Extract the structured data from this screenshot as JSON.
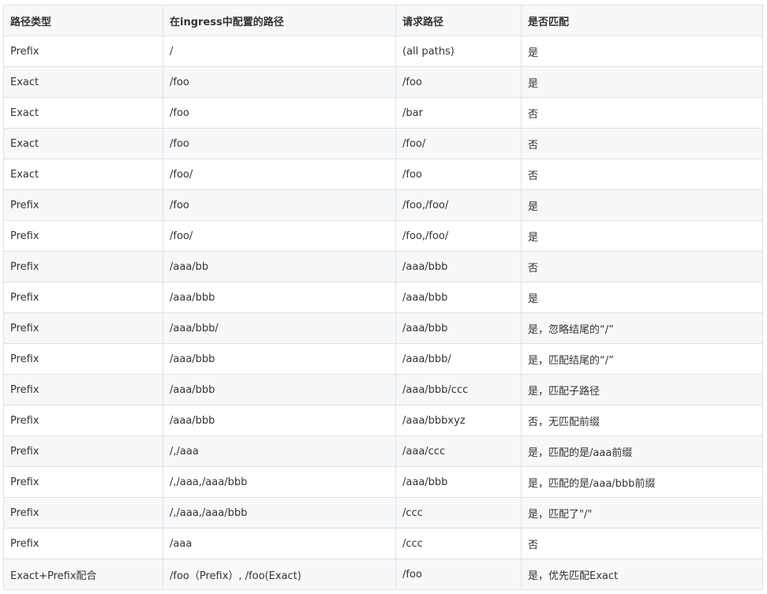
{
  "table": {
    "headers": [
      "路径类型",
      "在ingress中配置的路径",
      "请求路径",
      "是否匹配"
    ],
    "rows": [
      [
        "Prefix",
        "/",
        "(all paths)",
        "是"
      ],
      [
        "Exact",
        "/foo",
        "/foo",
        "是"
      ],
      [
        "Exact",
        "/foo",
        "/bar",
        "否"
      ],
      [
        "Exact",
        "/foo",
        "/foo/",
        "否"
      ],
      [
        "Exact",
        "/foo/",
        "/foo",
        "否"
      ],
      [
        "Prefix",
        "/foo",
        "/foo,/foo/",
        "是"
      ],
      [
        "Prefix",
        "/foo/",
        "/foo,/foo/",
        "是"
      ],
      [
        "Prefix",
        "/aaa/bb",
        "/aaa/bbb",
        "否"
      ],
      [
        "Prefix",
        "/aaa/bbb",
        "/aaa/bbb",
        "是"
      ],
      [
        "Prefix",
        "/aaa/bbb/",
        "/aaa/bbb",
        "是，忽略结尾的“/”"
      ],
      [
        "Prefix",
        "/aaa/bbb",
        "/aaa/bbb/",
        "是，匹配结尾的“/”"
      ],
      [
        "Prefix",
        "/aaa/bbb",
        "/aaa/bbb/ccc",
        "是，匹配子路径"
      ],
      [
        "Prefix",
        "/aaa/bbb",
        "/aaa/bbbxyz",
        "否，无匹配前缀"
      ],
      [
        "Prefix",
        "/,/aaa",
        "/aaa/ccc",
        "是，匹配的是/aaa前缀"
      ],
      [
        "Prefix",
        "/,/aaa,/aaa/bbb",
        "/aaa/bbb",
        "是，匹配的是/aaa/bbb前缀"
      ],
      [
        "Prefix",
        "/,/aaa,/aaa/bbb",
        "/ccc",
        "是，匹配了\"/\""
      ],
      [
        "Prefix",
        "/aaa",
        "/ccc",
        "否"
      ],
      [
        "Exact+Prefix配合",
        "/foo（Prefix）, /foo(Exact)",
        "/foo",
        "是，优先匹配Exact"
      ]
    ]
  }
}
